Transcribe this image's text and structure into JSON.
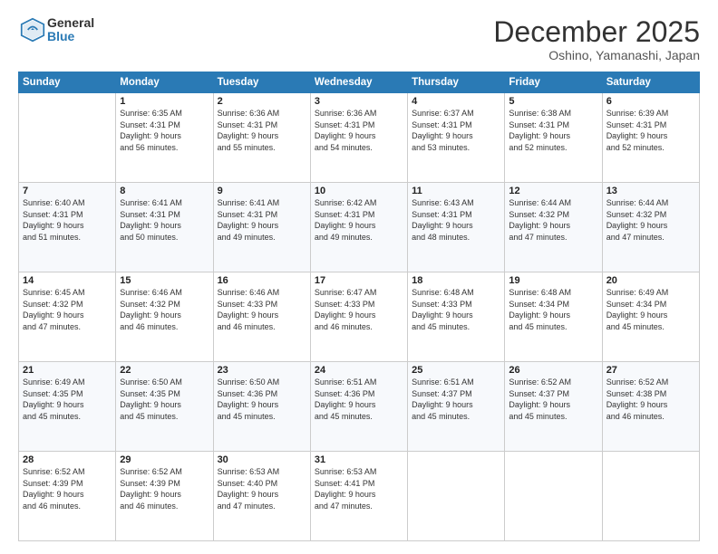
{
  "header": {
    "logo_general": "General",
    "logo_blue": "Blue",
    "month": "December 2025",
    "location": "Oshino, Yamanashi, Japan"
  },
  "days_of_week": [
    "Sunday",
    "Monday",
    "Tuesday",
    "Wednesday",
    "Thursday",
    "Friday",
    "Saturday"
  ],
  "weeks": [
    [
      {
        "day": "",
        "info": ""
      },
      {
        "day": "1",
        "info": "Sunrise: 6:35 AM\nSunset: 4:31 PM\nDaylight: 9 hours\nand 56 minutes."
      },
      {
        "day": "2",
        "info": "Sunrise: 6:36 AM\nSunset: 4:31 PM\nDaylight: 9 hours\nand 55 minutes."
      },
      {
        "day": "3",
        "info": "Sunrise: 6:36 AM\nSunset: 4:31 PM\nDaylight: 9 hours\nand 54 minutes."
      },
      {
        "day": "4",
        "info": "Sunrise: 6:37 AM\nSunset: 4:31 PM\nDaylight: 9 hours\nand 53 minutes."
      },
      {
        "day": "5",
        "info": "Sunrise: 6:38 AM\nSunset: 4:31 PM\nDaylight: 9 hours\nand 52 minutes."
      },
      {
        "day": "6",
        "info": "Sunrise: 6:39 AM\nSunset: 4:31 PM\nDaylight: 9 hours\nand 52 minutes."
      }
    ],
    [
      {
        "day": "7",
        "info": "Sunrise: 6:40 AM\nSunset: 4:31 PM\nDaylight: 9 hours\nand 51 minutes."
      },
      {
        "day": "8",
        "info": "Sunrise: 6:41 AM\nSunset: 4:31 PM\nDaylight: 9 hours\nand 50 minutes."
      },
      {
        "day": "9",
        "info": "Sunrise: 6:41 AM\nSunset: 4:31 PM\nDaylight: 9 hours\nand 49 minutes."
      },
      {
        "day": "10",
        "info": "Sunrise: 6:42 AM\nSunset: 4:31 PM\nDaylight: 9 hours\nand 49 minutes."
      },
      {
        "day": "11",
        "info": "Sunrise: 6:43 AM\nSunset: 4:31 PM\nDaylight: 9 hours\nand 48 minutes."
      },
      {
        "day": "12",
        "info": "Sunrise: 6:44 AM\nSunset: 4:32 PM\nDaylight: 9 hours\nand 47 minutes."
      },
      {
        "day": "13",
        "info": "Sunrise: 6:44 AM\nSunset: 4:32 PM\nDaylight: 9 hours\nand 47 minutes."
      }
    ],
    [
      {
        "day": "14",
        "info": "Sunrise: 6:45 AM\nSunset: 4:32 PM\nDaylight: 9 hours\nand 47 minutes."
      },
      {
        "day": "15",
        "info": "Sunrise: 6:46 AM\nSunset: 4:32 PM\nDaylight: 9 hours\nand 46 minutes."
      },
      {
        "day": "16",
        "info": "Sunrise: 6:46 AM\nSunset: 4:33 PM\nDaylight: 9 hours\nand 46 minutes."
      },
      {
        "day": "17",
        "info": "Sunrise: 6:47 AM\nSunset: 4:33 PM\nDaylight: 9 hours\nand 46 minutes."
      },
      {
        "day": "18",
        "info": "Sunrise: 6:48 AM\nSunset: 4:33 PM\nDaylight: 9 hours\nand 45 minutes."
      },
      {
        "day": "19",
        "info": "Sunrise: 6:48 AM\nSunset: 4:34 PM\nDaylight: 9 hours\nand 45 minutes."
      },
      {
        "day": "20",
        "info": "Sunrise: 6:49 AM\nSunset: 4:34 PM\nDaylight: 9 hours\nand 45 minutes."
      }
    ],
    [
      {
        "day": "21",
        "info": "Sunrise: 6:49 AM\nSunset: 4:35 PM\nDaylight: 9 hours\nand 45 minutes."
      },
      {
        "day": "22",
        "info": "Sunrise: 6:50 AM\nSunset: 4:35 PM\nDaylight: 9 hours\nand 45 minutes."
      },
      {
        "day": "23",
        "info": "Sunrise: 6:50 AM\nSunset: 4:36 PM\nDaylight: 9 hours\nand 45 minutes."
      },
      {
        "day": "24",
        "info": "Sunrise: 6:51 AM\nSunset: 4:36 PM\nDaylight: 9 hours\nand 45 minutes."
      },
      {
        "day": "25",
        "info": "Sunrise: 6:51 AM\nSunset: 4:37 PM\nDaylight: 9 hours\nand 45 minutes."
      },
      {
        "day": "26",
        "info": "Sunrise: 6:52 AM\nSunset: 4:37 PM\nDaylight: 9 hours\nand 45 minutes."
      },
      {
        "day": "27",
        "info": "Sunrise: 6:52 AM\nSunset: 4:38 PM\nDaylight: 9 hours\nand 46 minutes."
      }
    ],
    [
      {
        "day": "28",
        "info": "Sunrise: 6:52 AM\nSunset: 4:39 PM\nDaylight: 9 hours\nand 46 minutes."
      },
      {
        "day": "29",
        "info": "Sunrise: 6:52 AM\nSunset: 4:39 PM\nDaylight: 9 hours\nand 46 minutes."
      },
      {
        "day": "30",
        "info": "Sunrise: 6:53 AM\nSunset: 4:40 PM\nDaylight: 9 hours\nand 47 minutes."
      },
      {
        "day": "31",
        "info": "Sunrise: 6:53 AM\nSunset: 4:41 PM\nDaylight: 9 hours\nand 47 minutes."
      },
      {
        "day": "",
        "info": ""
      },
      {
        "day": "",
        "info": ""
      },
      {
        "day": "",
        "info": ""
      }
    ]
  ]
}
